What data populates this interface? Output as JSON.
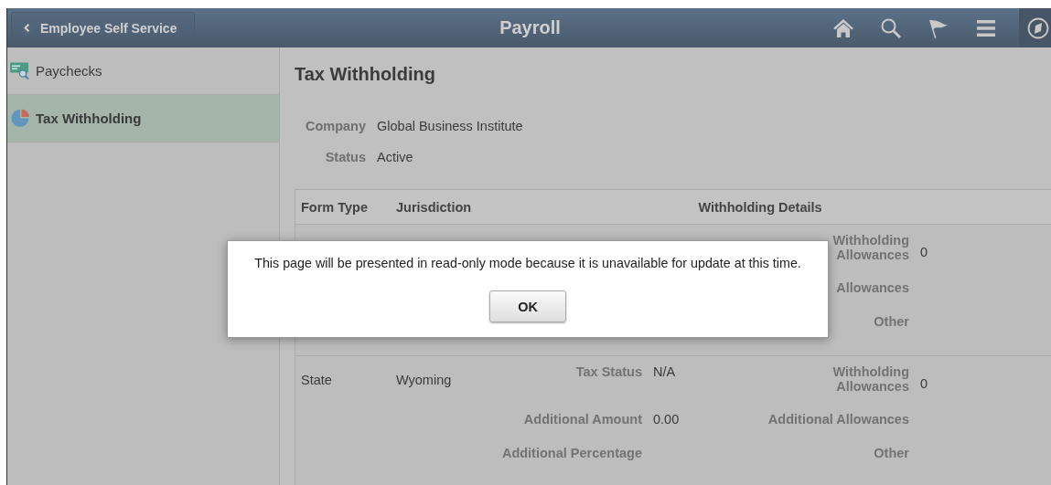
{
  "header": {
    "back_button": "Employee Self Service",
    "title": "Payroll"
  },
  "sidebar": {
    "items": [
      {
        "label": "Paychecks",
        "selected": false
      },
      {
        "label": "Tax Withholding",
        "selected": true
      }
    ]
  },
  "page": {
    "title": "Tax Withholding",
    "fields": [
      {
        "label": "Company",
        "value": "Global Business Institute"
      },
      {
        "label": "Status",
        "value": "Active"
      }
    ]
  },
  "table": {
    "columns": [
      "Form Type",
      "Jurisdiction",
      "Withholding Details"
    ],
    "rows": [
      {
        "lines": [
          {
            "right_label": "Withholding Allowances",
            "right_value": "0"
          },
          {
            "right_label": "Allowances"
          },
          {
            "right_label": "Other"
          }
        ]
      },
      {
        "form_type": "State",
        "jurisdiction": "Wyoming",
        "lines": [
          {
            "left_label": "Tax Status",
            "left_value": "N/A",
            "right_label": "Withholding Allowances",
            "right_value": "0"
          },
          {
            "left_label": "Additional Amount",
            "left_value": "0.00",
            "right_label": "Additional Allowances"
          },
          {
            "left_label": "Additional Percentage",
            "right_label": "Other"
          }
        ]
      }
    ]
  },
  "dialog": {
    "message": "This page will be presented in read-only mode because it is unavailable for update at this time.",
    "button": "OK"
  }
}
